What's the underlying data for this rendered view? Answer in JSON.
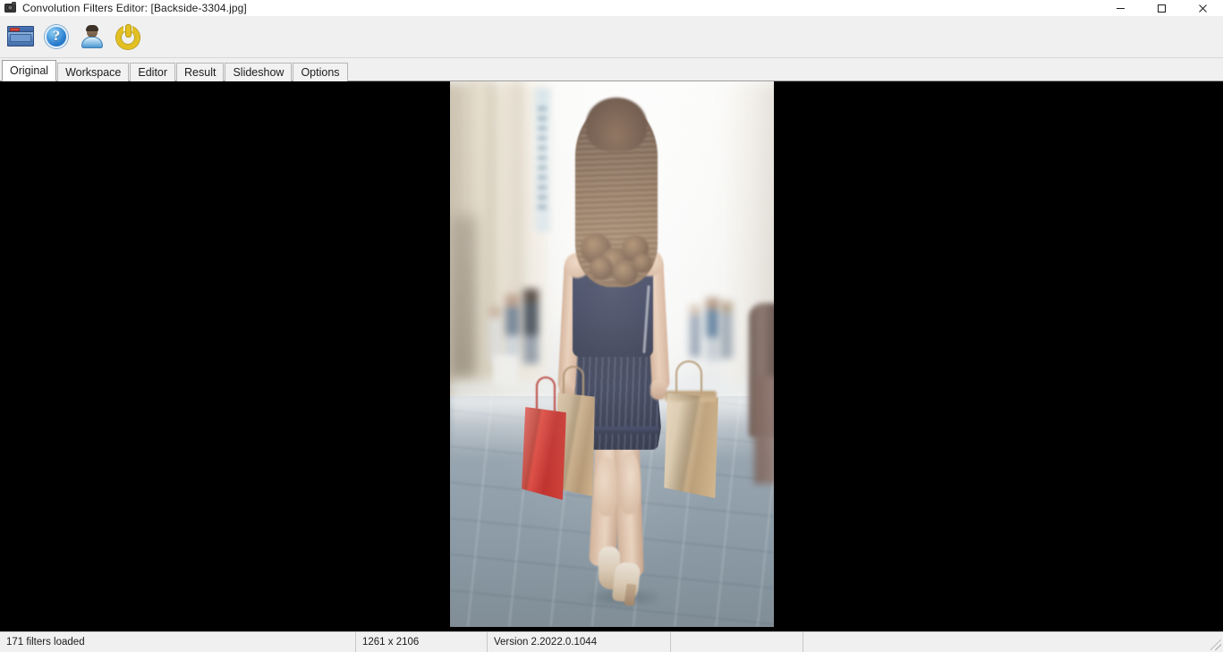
{
  "window": {
    "title": "Convolution Filters Editor: [Backside-3304.jpg]",
    "app_icon": "camera-icon",
    "controls": {
      "minimize": "minimize-icon",
      "maximize": "maximize-icon",
      "close": "close-icon"
    }
  },
  "toolbar": {
    "buttons": [
      {
        "name": "open-image-button",
        "icon": "open-folder-icon",
        "tooltip": "Open"
      },
      {
        "name": "help-button",
        "icon": "help-question-icon",
        "tooltip": "Help"
      },
      {
        "name": "about-button",
        "icon": "user-person-icon",
        "tooltip": "About"
      },
      {
        "name": "exit-button",
        "icon": "power-icon",
        "tooltip": "Exit"
      }
    ]
  },
  "tabs": {
    "active": "Original",
    "items": [
      {
        "label": "Original"
      },
      {
        "label": "Workspace"
      },
      {
        "label": "Editor"
      },
      {
        "label": "Result"
      },
      {
        "label": "Slideshow"
      },
      {
        "label": "Options"
      }
    ]
  },
  "canvas": {
    "background_color": "#000000",
    "image": {
      "alt": "Woman walking away down a sunlit city street carrying a red shopping bag and two tan paper bags",
      "file_name": "Backside-3304.jpg",
      "dimensions": "1261 x 2106"
    }
  },
  "statusbar": {
    "cells": [
      {
        "name": "filters-loaded-status",
        "text": "171 filters loaded"
      },
      {
        "name": "image-dimensions-status",
        "text": "1261 x 2106"
      },
      {
        "name": "version-status",
        "text": "Version 2.2022.0.1044"
      },
      {
        "name": "status-cell-4",
        "text": ""
      },
      {
        "name": "status-cell-5",
        "text": ""
      }
    ]
  },
  "colors": {
    "chrome": "#f0f0f0",
    "canvas": "#000000",
    "accent": "#2a7fd0",
    "power": "#e3c021"
  }
}
